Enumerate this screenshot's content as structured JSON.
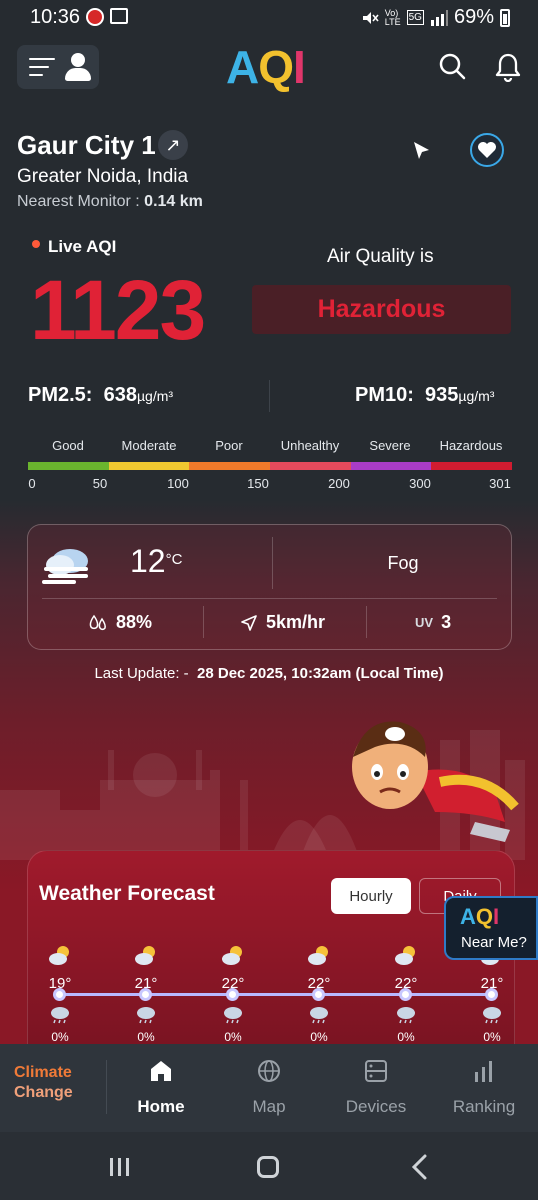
{
  "status_bar": {
    "time": "10:36",
    "battery": "69%",
    "net_small": "Vo)\nLTE",
    "net_5g": "5G"
  },
  "header": {
    "logo_a": "A",
    "logo_q": "Q",
    "logo_i": "I"
  },
  "location": {
    "name": "Gaur City 1",
    "region": "Greater Noida, India",
    "nearest_label": "Nearest Monitor :",
    "nearest_value": "0.14 km"
  },
  "aqi": {
    "live_label": "Live AQI",
    "value": "1123",
    "quality_label": "Air Quality is",
    "status": "Hazardous",
    "status_color": "#e02236"
  },
  "pollutants": {
    "pm25_label": "PM2.5:",
    "pm25_value": "638",
    "pm10_label": "PM10:",
    "pm10_value": "935",
    "unit": "µg/m³"
  },
  "scale": {
    "labels": [
      "Good",
      "Moderate",
      "Poor",
      "Unhealthy",
      "Severe",
      "Hazardous"
    ],
    "numbers": [
      "0",
      "50",
      "100",
      "150",
      "200",
      "300",
      "301"
    ],
    "colors": [
      "#6ab42e",
      "#f0c830",
      "#f07a2a",
      "#e44a5c",
      "#a93cc6",
      "#d01c30"
    ]
  },
  "weather": {
    "temp": "12",
    "temp_unit": "°C",
    "condition": "Fog",
    "humidity": "88%",
    "wind": "5km/hr",
    "uv_label": "UV",
    "uv_value": "3"
  },
  "last_update": {
    "label": "Last Update: -",
    "value": "28 Dec 2025, 10:32am (Local Time)"
  },
  "forecast": {
    "title": "Weather Forecast",
    "tab_hourly": "Hourly",
    "tab_daily": "Daily",
    "hours": [
      {
        "temp": "19°",
        "rain": "0%"
      },
      {
        "temp": "21°",
        "rain": "0%"
      },
      {
        "temp": "22°",
        "rain": "0%"
      },
      {
        "temp": "22°",
        "rain": "0%"
      },
      {
        "temp": "22°",
        "rain": "0%"
      },
      {
        "temp": "21°",
        "rain": "0%"
      }
    ]
  },
  "near_me": {
    "label": "Near Me?"
  },
  "bottom_nav": {
    "climate_line1": "Climate",
    "climate_line2": "Change",
    "home": "Home",
    "map": "Map",
    "devices": "Devices",
    "ranking": "Ranking"
  }
}
